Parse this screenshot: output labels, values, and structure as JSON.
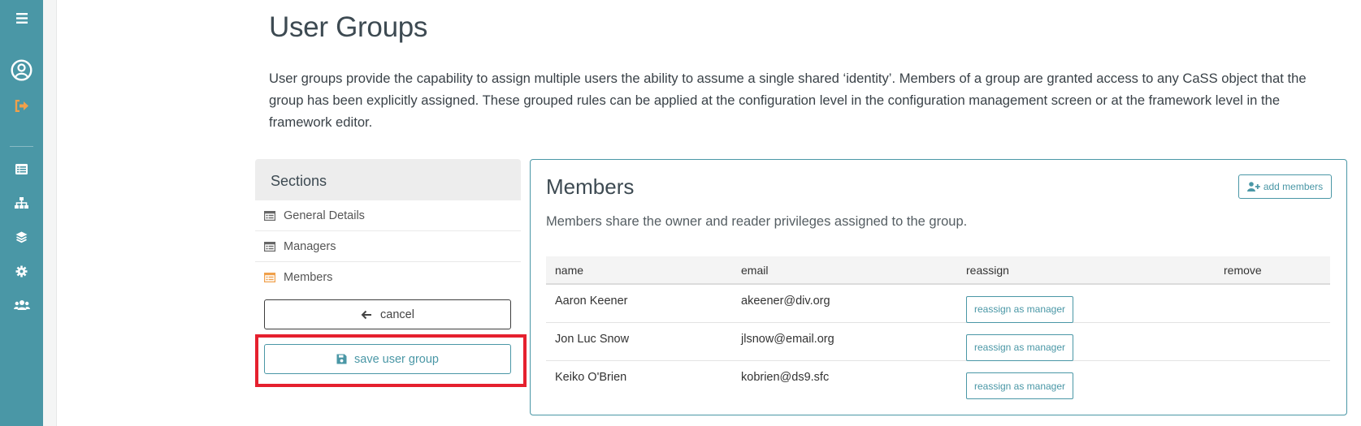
{
  "nav": {
    "items": [
      {
        "icon": "menu-icon"
      },
      {
        "icon": "user-circle-icon"
      },
      {
        "icon": "logout-icon"
      },
      {
        "icon": "list-icon"
      },
      {
        "icon": "sitemap-icon"
      },
      {
        "icon": "layers-icon"
      },
      {
        "icon": "gear-icon"
      },
      {
        "icon": "users-icon"
      }
    ]
  },
  "page": {
    "title": "User Groups",
    "intro": "User groups provide the capability to assign multiple users the ability to assume a single shared ‘identity’. Members of a group are granted access to any CaSS object that the group has been explicitly assigned. These grouped rules can be applied at the configuration level in the configuration management screen or at the framework level in the framework editor."
  },
  "sections": {
    "heading": "Sections",
    "items": [
      {
        "label": "General Details",
        "icon": "table-icon",
        "active": false
      },
      {
        "label": "Managers",
        "icon": "table-icon",
        "active": false
      },
      {
        "label": "Members",
        "icon": "table-icon",
        "active": true
      }
    ],
    "cancel_label": "cancel",
    "save_label": "save user group"
  },
  "members": {
    "title": "Members",
    "add_label": "add members",
    "description": "Members share the owner and reader privileges assigned to the group.",
    "columns": [
      "name",
      "email",
      "reassign",
      "remove"
    ],
    "rows": [
      {
        "name": "Aaron Keener",
        "email": "akeener@div.org",
        "action": "reassign as manager"
      },
      {
        "name": "Jon Luc Snow",
        "email": "jlsnow@email.org",
        "action": "reassign as manager"
      },
      {
        "name": "Keiko O'Brien",
        "email": "kobrien@ds9.sfc",
        "action": "reassign as manager"
      }
    ]
  },
  "colors": {
    "accent": "#4a97a6",
    "active": "#f0a04b",
    "danger": "#e5202e"
  }
}
